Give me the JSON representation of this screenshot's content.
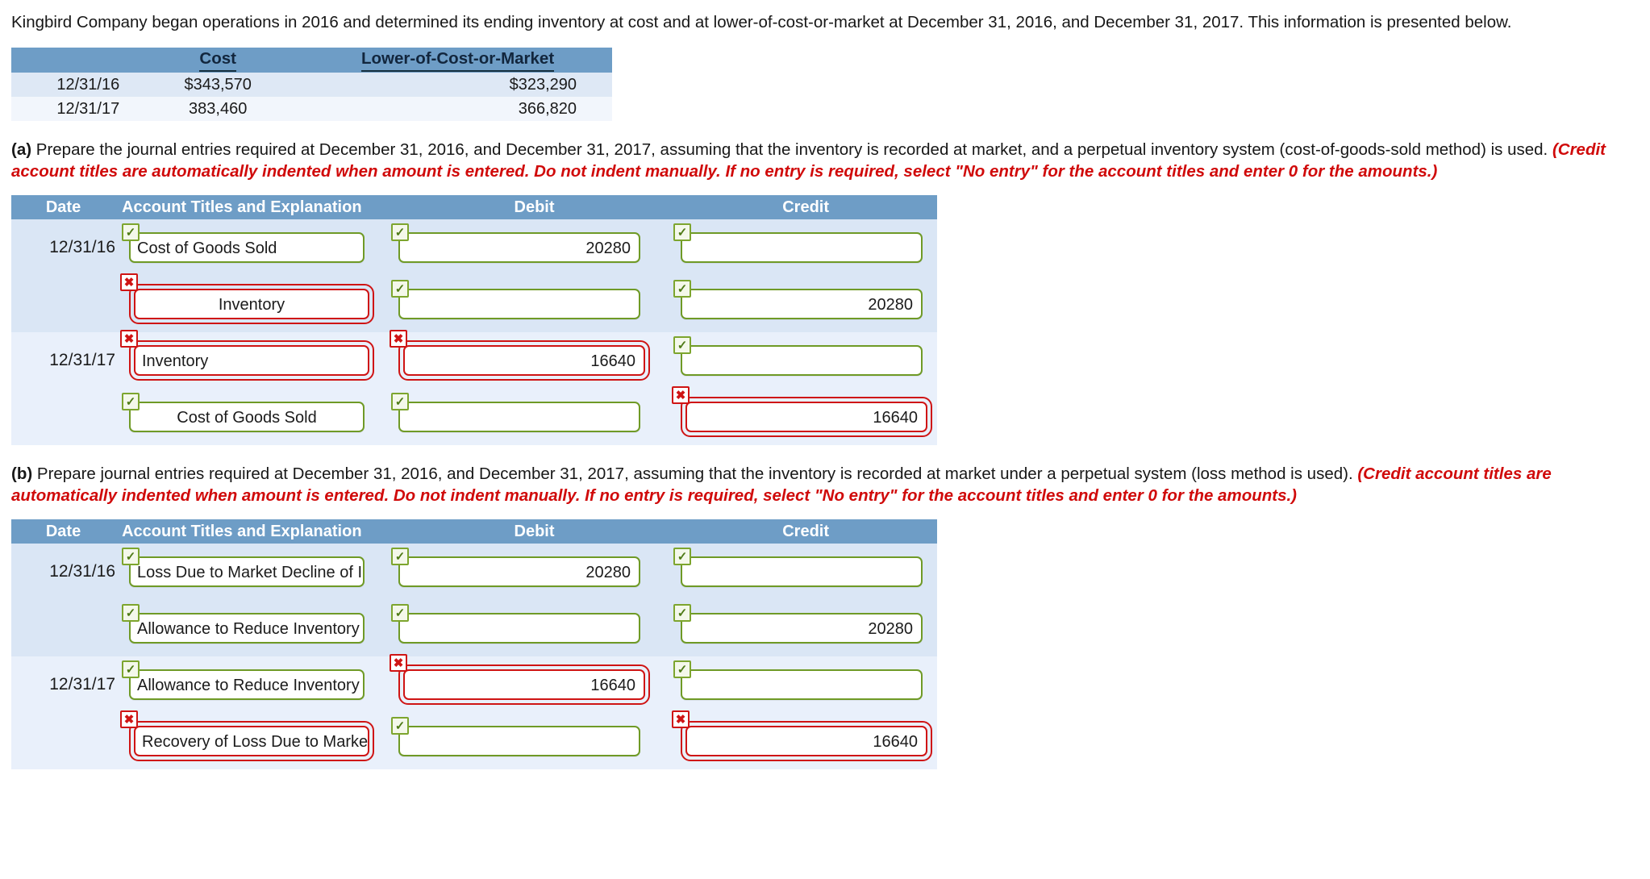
{
  "intro": {
    "text": "Kingbird Company began operations in 2016 and determined its ending inventory at cost and at lower-of-cost-or-market at December 31, 2016, and December 31, 2017. This information is presented below."
  },
  "cost_table": {
    "headers": {
      "blank": "",
      "cost": "Cost",
      "lcm": "Lower-of-Cost-or-Market"
    },
    "rows": [
      {
        "date": "12/31/16",
        "cost": "$343,570",
        "lcm": "$323,290"
      },
      {
        "date": "12/31/17",
        "cost": "383,460",
        "lcm": "366,820"
      }
    ]
  },
  "part_a": {
    "label": "(a)",
    "black": "Prepare the journal entries required at December 31, 2016, and December 31, 2017, assuming that the inventory is recorded at market, and a perpetual inventory system (cost-of-goods-sold method) is used.",
    "red": "(Credit account titles are automatically indented when amount is entered. Do not indent manually. If no entry is required, select \"No entry\" for the account titles and enter 0 for the amounts.)"
  },
  "part_b": {
    "label": "(b)",
    "black": "Prepare journal entries required at December 31, 2016, and December 31, 2017, assuming that the inventory is recorded at market under a perpetual system (loss method is used).",
    "red": "(Credit account titles are automatically indented when amount is entered. Do not indent manually. If no entry is required, select \"No entry\" for the account titles and enter 0 for the amounts.)"
  },
  "journal_headers": {
    "date": "Date",
    "account": "Account Titles and Explanation",
    "debit": "Debit",
    "credit": "Credit"
  },
  "icons": {
    "ok": "✓",
    "err": "✖"
  },
  "colors": {
    "header_blue": "#6e9dc6",
    "row_a": "#dae6f5",
    "row_b": "#e9f0fb",
    "ok_green": "#6f9a26",
    "err_red": "#cf1414",
    "instruction_red": "#d00a0a"
  },
  "journal_a": {
    "rows": [
      {
        "date": "12/31/16",
        "indent": false,
        "account": {
          "value": "Cost of Goods Sold",
          "state": "ok"
        },
        "debit": {
          "value": "20280",
          "state": "ok"
        },
        "credit": {
          "value": "",
          "state": "ok"
        },
        "band": "a"
      },
      {
        "date": "",
        "indent": true,
        "account": {
          "value": "Inventory",
          "state": "err"
        },
        "debit": {
          "value": "",
          "state": "ok"
        },
        "credit": {
          "value": "20280",
          "state": "ok"
        },
        "band": "a"
      },
      {
        "date": "12/31/17",
        "indent": false,
        "account": {
          "value": "Inventory",
          "state": "err"
        },
        "debit": {
          "value": "16640",
          "state": "err"
        },
        "credit": {
          "value": "",
          "state": "ok"
        },
        "band": "b"
      },
      {
        "date": "",
        "indent": true,
        "account": {
          "value": "Cost of Goods Sold",
          "state": "ok"
        },
        "debit": {
          "value": "",
          "state": "ok"
        },
        "credit": {
          "value": "16640",
          "state": "err"
        },
        "band": "b"
      }
    ]
  },
  "journal_b": {
    "rows": [
      {
        "date": "12/31/16",
        "indent": false,
        "account": {
          "value": "Loss Due to Market Decline of Inventory",
          "state": "ok"
        },
        "debit": {
          "value": "20280",
          "state": "ok"
        },
        "credit": {
          "value": "",
          "state": "ok"
        },
        "band": "a"
      },
      {
        "date": "",
        "indent": true,
        "account": {
          "value": "Allowance to Reduce Inventory to Market",
          "state": "ok"
        },
        "debit": {
          "value": "",
          "state": "ok"
        },
        "credit": {
          "value": "20280",
          "state": "ok"
        },
        "band": "a"
      },
      {
        "date": "12/31/17",
        "indent": false,
        "account": {
          "value": "Allowance to Reduce Inventory to Market",
          "state": "ok"
        },
        "debit": {
          "value": "16640",
          "state": "err"
        },
        "credit": {
          "value": "",
          "state": "ok"
        },
        "band": "b"
      },
      {
        "date": "",
        "indent": true,
        "account": {
          "value": "Recovery of Loss Due to Market Decline of Inventory",
          "state": "err"
        },
        "debit": {
          "value": "",
          "state": "ok"
        },
        "credit": {
          "value": "16640",
          "state": "err"
        },
        "band": "b"
      }
    ]
  }
}
